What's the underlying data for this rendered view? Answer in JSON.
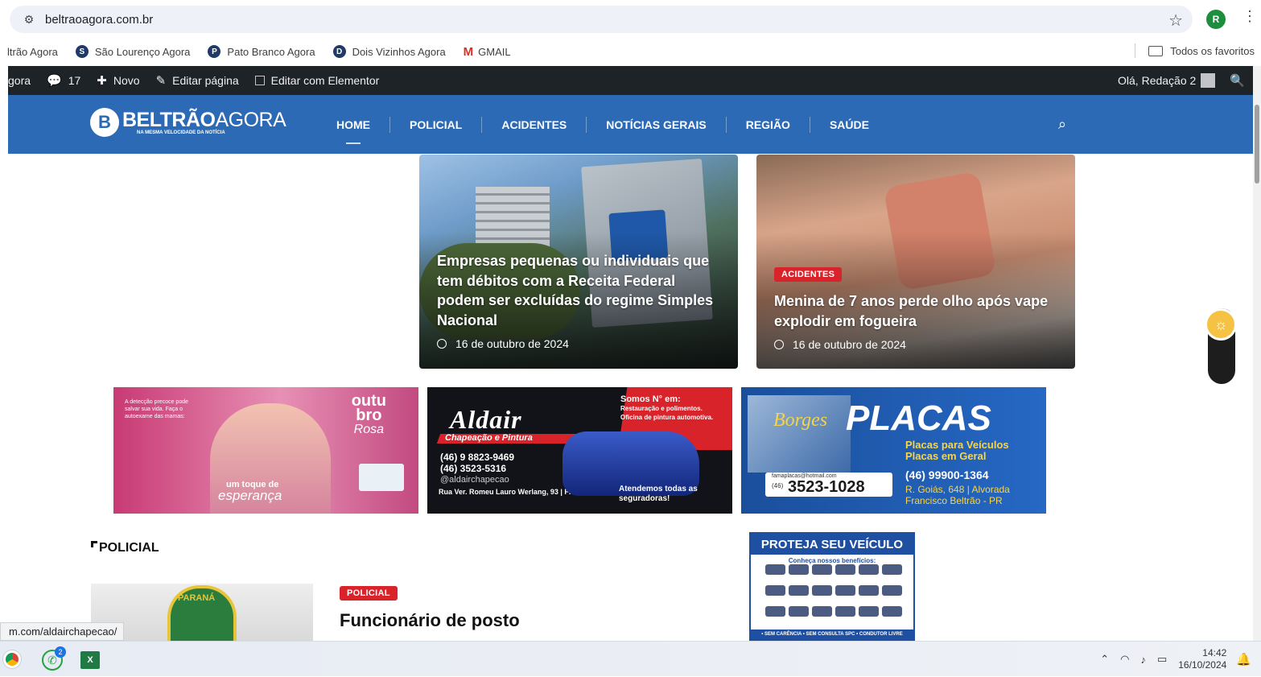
{
  "browser": {
    "url": "beltraoagora.com.br",
    "profile_initial": "R",
    "bookmarks": [
      {
        "label": "ltrão Agora"
      },
      {
        "label": "São Lourenço Agora"
      },
      {
        "label": "Pato Branco Agora"
      },
      {
        "label": "Dois Vizinhos Agora"
      },
      {
        "label": "GMAIL"
      }
    ],
    "all_bookmarks_label": "Todos os favoritos"
  },
  "adminbar": {
    "site": "gora",
    "comments": "17",
    "new": "Novo",
    "edit_page": "Editar página",
    "edit_elementor": "Editar com Elementor",
    "greeting": "Olá, Redação 2"
  },
  "header": {
    "logo_bold": "BELTRÃO",
    "logo_light": "AGORA",
    "tagline": "NA MESMA VELOCIDADE DA NOTÍCIA",
    "nav": [
      "HOME",
      "POLICIAL",
      "ACIDENTES",
      "NOTÍCIAS GERAIS",
      "REGIÃO",
      "SAÚDE"
    ],
    "active_index": 0
  },
  "featured": [
    {
      "title": "Empresas pequenas ou individuais que tem débitos com a Receita Federal podem ser excluídas do regime Simples Nacional",
      "date": "16 de outubro de 2024"
    },
    {
      "tag": "ACIDENTES",
      "title": "Menina de 7 anos perde olho após vape explodir em fogueira",
      "date": "16 de outubro de 2024"
    }
  ],
  "banners": {
    "b1": {
      "small": "A detecção precoce pode salvar sua vida. Faça o autoexame das mamas:",
      "outu": "outu",
      "bro": "bro",
      "rosa": "Rosa",
      "toque": "um toque de",
      "esperanca": "esperança"
    },
    "b2": {
      "name": "Aldair",
      "sub": "Chapeação e Pintura",
      "phone1": "(46) 9 8823-9469",
      "phone2": "(46) 3523-5316",
      "instagram": "@aldairchapecao",
      "address": "Rua Ver. Romeu Lauro Werlang, 93 | Francisco Beltrão-PR",
      "somos": "Somos N° em:",
      "somos2": "Restauração e polimentos.",
      "somos3": "Oficina de pintura automotiva.",
      "atend": "Atendemos todas as seguradoras!"
    },
    "b3": {
      "borges": "Borges",
      "placas": "PLACAS",
      "pv1": "Placas para Veículos",
      "pv2": "Placas em Geral",
      "phone": "(46) 99900-1364",
      "addr1": "R. Goiás, 648 | Alvorada",
      "addr2": "Francisco Beltrão - PR",
      "email": "famaplacas@hotmail.com",
      "area": "(46)",
      "landline": "3523-1028"
    },
    "side": {
      "title": "PROTEJA SEU VEÍCULO",
      "sub": "Conheça nossos benefícios:",
      "footer": "• SEM CARÊNCIA • SEM CONSULTA SPC • CONDUTOR LIVRE"
    }
  },
  "policial": {
    "section_title": "POLICIAL",
    "tag": "POLICIAL",
    "post_title": "Funcionário de posto",
    "image_text": "PARANÁ"
  },
  "status_url": "m.com/aldairchapecao/",
  "taskbar": {
    "wa_badge": "2",
    "time": "14:42",
    "date": "16/10/2024"
  }
}
